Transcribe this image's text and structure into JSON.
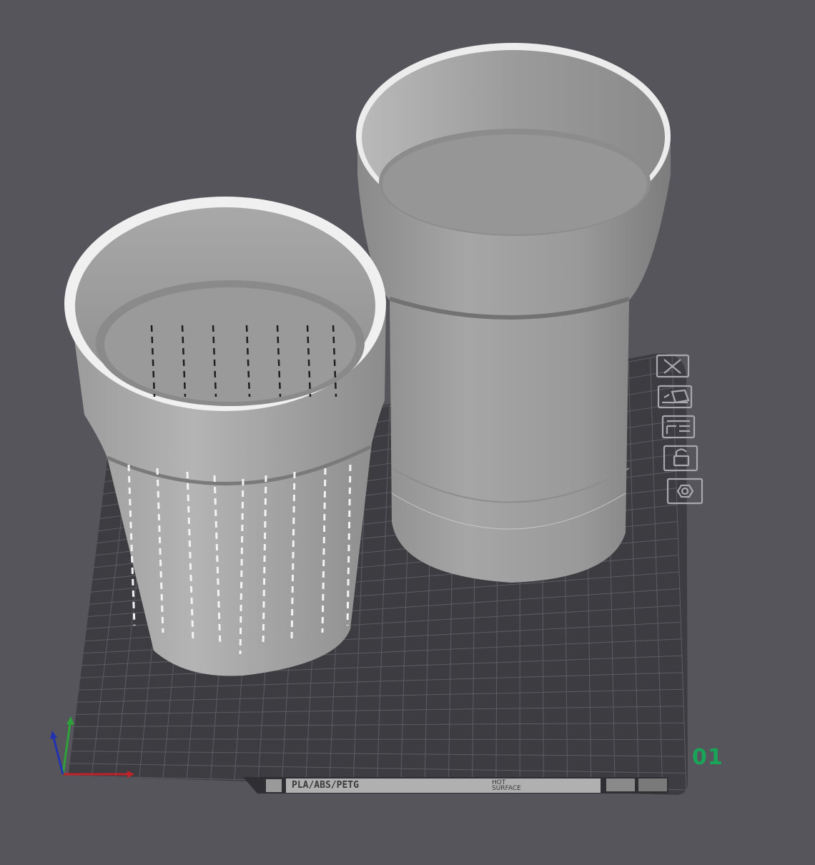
{
  "viewport": {
    "background_color": "#55555b",
    "bed_color": "#3c3c41",
    "grid_color": "#5c5c63",
    "model_color": "#a0a0a0"
  },
  "plate": {
    "number": "01",
    "number_color": "#18a558",
    "filament_label": "PLA/ABS/PETG",
    "hot_surface_line1": "HOT",
    "hot_surface_line2": "SURFACE"
  },
  "plate_toolbar": [
    {
      "name": "close-plate-button",
      "icon": "close-icon"
    },
    {
      "name": "auto-arrange-button",
      "icon": "arrange-icon"
    },
    {
      "name": "plate-layout-button",
      "icon": "layout-icon"
    },
    {
      "name": "lock-plate-button",
      "icon": "unlock-icon"
    },
    {
      "name": "plate-settings-button",
      "icon": "hexagon-settings-icon"
    }
  ],
  "axes": {
    "x_color": "#c0222a",
    "y_color": "#2ea23a",
    "z_color": "#2232b0"
  },
  "objects": [
    {
      "name": "strainer-basket",
      "type": "perforated cylinder"
    },
    {
      "name": "outer-cup",
      "type": "cylinder"
    }
  ]
}
